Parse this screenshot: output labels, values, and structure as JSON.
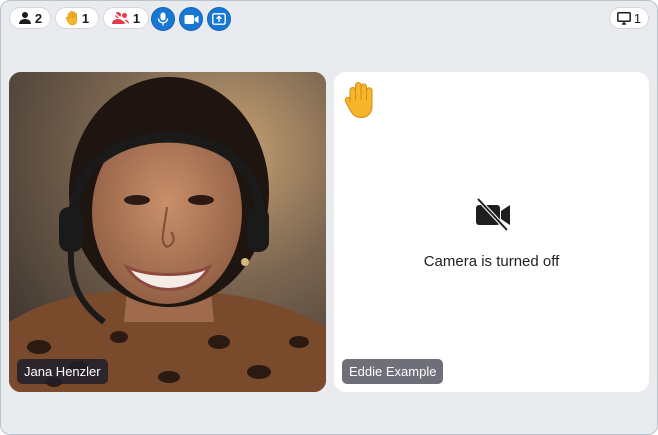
{
  "toolbar": {
    "participants_count": "2",
    "raised_hands_count": "1",
    "muted_count": "1",
    "screens_count": "1"
  },
  "participants": [
    {
      "name": "Jana Henzler",
      "video": "on"
    },
    {
      "name": "Eddie Example",
      "video": "off",
      "camera_status": "Camera is turned off",
      "hand_raised": true
    }
  ],
  "colors": {
    "accent": "#1877d2",
    "background": "#e9ebef",
    "muted_red": "#e5394b",
    "hand_yellow": "#f6b52a"
  },
  "icons": {
    "participants": "person-icon",
    "hands": "raised-hand-icon",
    "muted": "muted-people-icon",
    "mic": "microphone-icon",
    "camera": "video-camera-icon",
    "share": "share-screen-icon",
    "screens": "monitor-icon",
    "camera_off": "camera-off-icon"
  }
}
